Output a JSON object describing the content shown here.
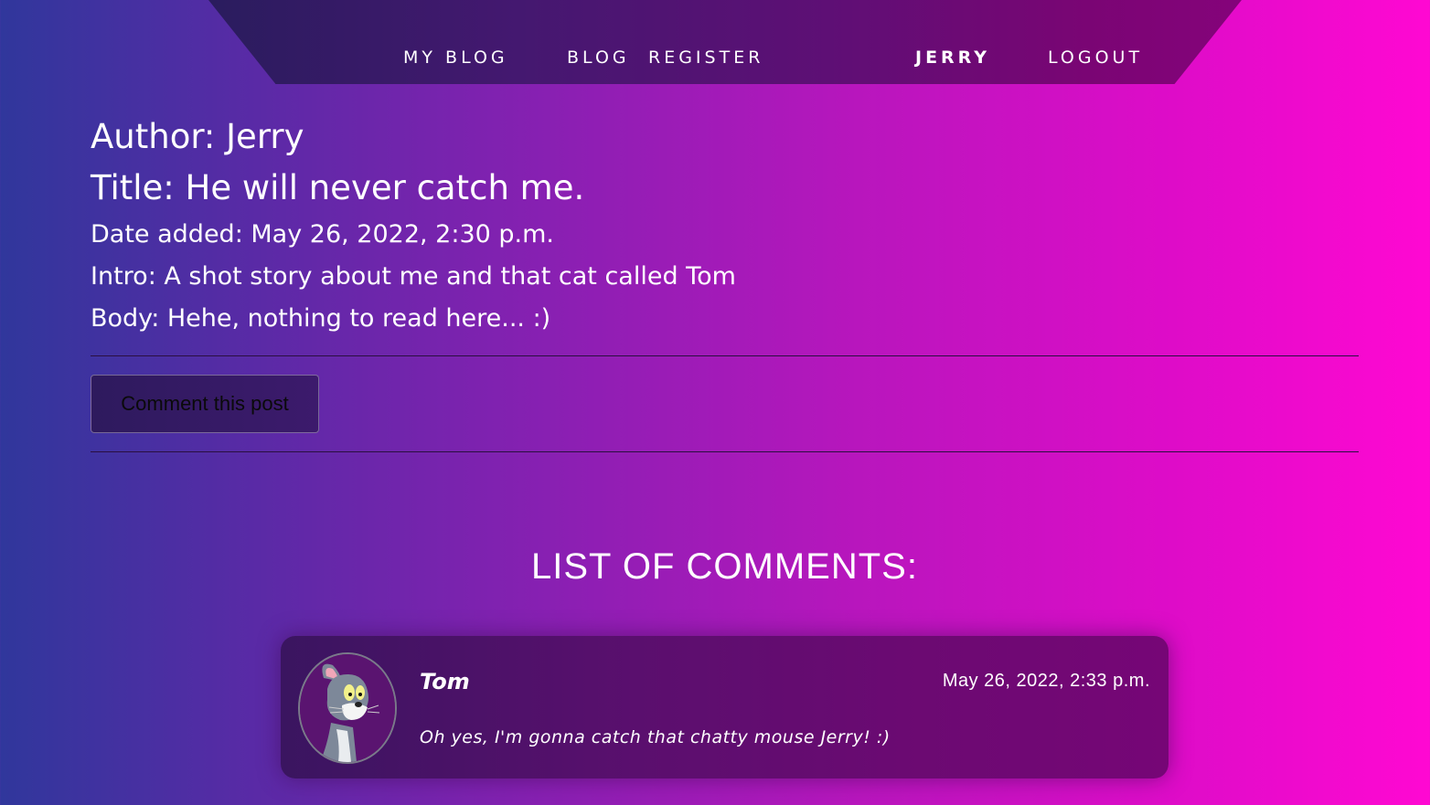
{
  "nav": {
    "my_blog": "MY BLOG",
    "blog": "BLOG",
    "register": "REGISTER",
    "user": "JERRY",
    "logout": "LOGOUT"
  },
  "post": {
    "author": "Author: Jerry",
    "title": "Title: He will never catch me.",
    "date_added": "Date added: May 26, 2022, 2:30 p.m.",
    "intro": "Intro: A shot story about me and that cat called Tom",
    "body": "Body: Hehe, nothing to read here... :)"
  },
  "actions": {
    "comment_button": "Comment this post"
  },
  "comments": {
    "heading": "LIST OF COMMENTS:",
    "items": [
      {
        "author": "Tom",
        "date": "May 26, 2022, 2:33 p.m.",
        "text": "Oh yes, I'm gonna catch that chatty mouse Jerry! :)",
        "avatar": "tom-cat-avatar"
      }
    ]
  },
  "colors": {
    "background_left": "#30379c",
    "background_right": "#ff08d2",
    "navbar": "#441870",
    "card": "#5a0f6e"
  }
}
